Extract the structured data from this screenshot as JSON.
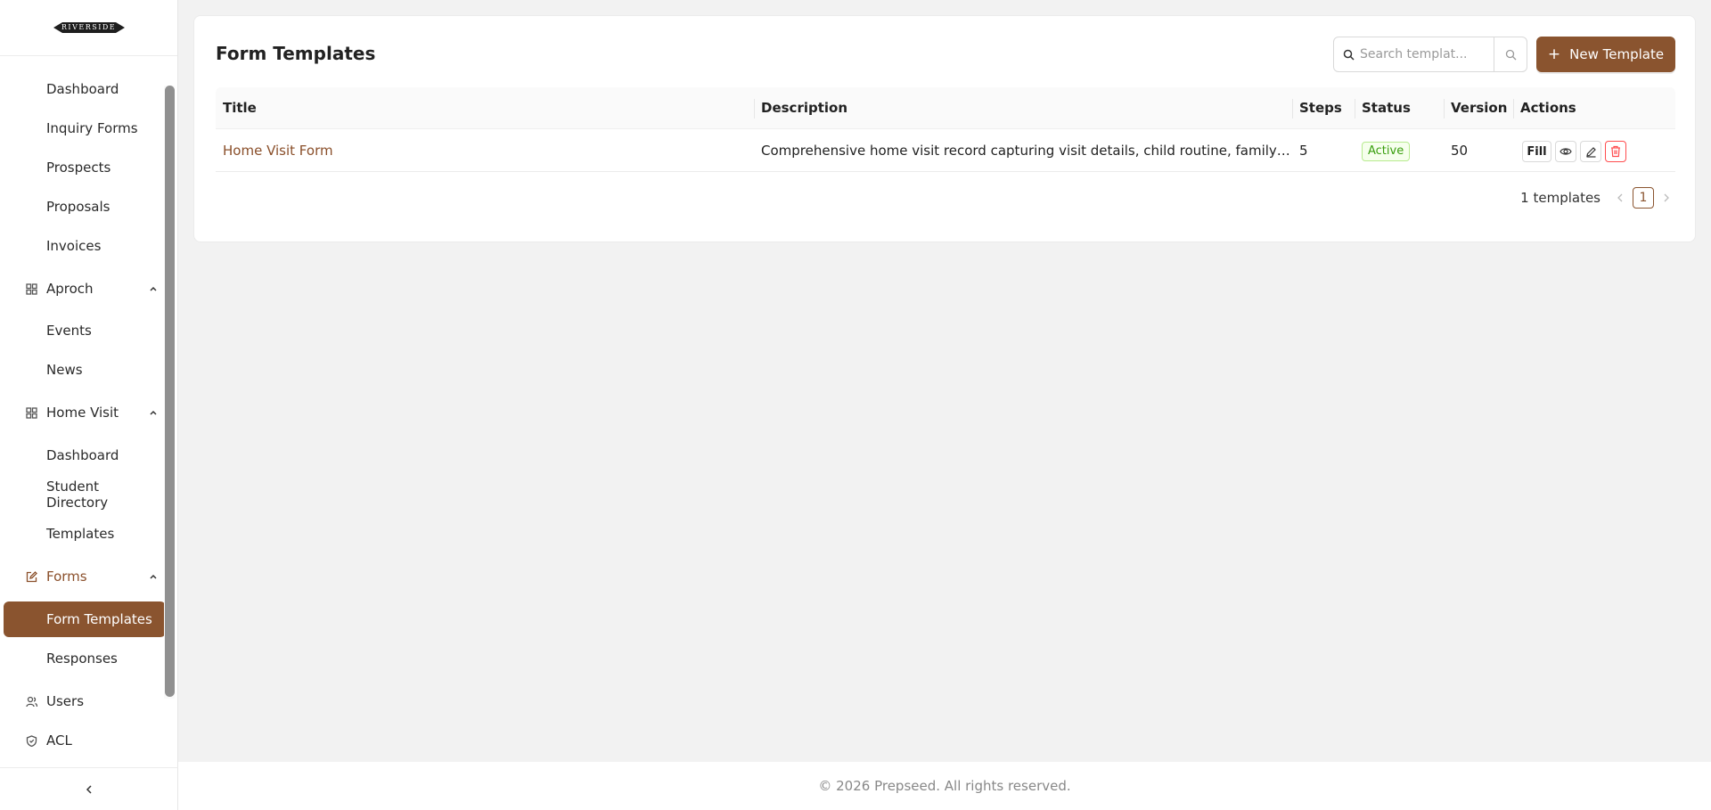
{
  "brand": {
    "logo_text": "RIVERSIDE"
  },
  "sidebar": {
    "items": [
      {
        "label": "Dashboard"
      },
      {
        "label": "Inquiry Forms"
      },
      {
        "label": "Prospects"
      },
      {
        "label": "Proposals"
      },
      {
        "label": "Invoices"
      },
      {
        "label": "Aproch",
        "icon": "grid-icon",
        "expanded": true
      },
      {
        "label": "Events"
      },
      {
        "label": "News"
      },
      {
        "label": "Home Visit",
        "icon": "grid-icon",
        "expanded": true
      },
      {
        "label": "Dashboard"
      },
      {
        "label": "Student Directory"
      },
      {
        "label": "Templates"
      },
      {
        "label": "Forms",
        "icon": "edit-icon",
        "expanded": true,
        "active": true
      },
      {
        "label": "Form Templates",
        "selected": true
      },
      {
        "label": "Responses"
      },
      {
        "label": "Users",
        "icon": "users-icon"
      },
      {
        "label": "ACL",
        "icon": "shield-icon"
      }
    ]
  },
  "header": {
    "title": "Form Templates",
    "search_placeholder": "Search templat...",
    "new_button_label": "New Template"
  },
  "table": {
    "columns": [
      "Title",
      "Description",
      "Steps",
      "Status",
      "Version",
      "Actions"
    ],
    "rows": [
      {
        "title": "Home Visit Form",
        "description": "Comprehensive home visit record capturing visit details, child routine, family back...",
        "steps": "5",
        "status": "Active",
        "version": "50",
        "actions": {
          "fill_label": "Fill"
        }
      }
    ]
  },
  "pagination": {
    "count_label": "1 templates",
    "current_page": "1"
  },
  "footer": {
    "text": "© 2026 Prepseed. All rights reserved."
  },
  "colors": {
    "accent": "#8a542f",
    "status_active": "#389e0d",
    "danger": "#ff4d4f"
  }
}
